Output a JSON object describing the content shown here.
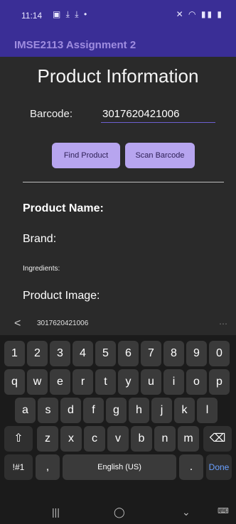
{
  "status_bar": {
    "time": "11:14",
    "left_icons": "▣ ⤓ ⤓ •",
    "right_icons": "✕ ◠ ▮▮ ▮"
  },
  "app_bar": {
    "title": "IMSE2113 Assignment 2"
  },
  "content": {
    "page_title": "Product Information",
    "barcode_label": "Barcode:",
    "barcode_value": "3017620421006",
    "find_button": "Find Product",
    "scan_button": "Scan Barcode",
    "product_name_label": "Product Name:",
    "brand_label": "Brand:",
    "ingredients_label": "Ingredients:",
    "product_image_label": "Product Image:"
  },
  "keyboard": {
    "clipboard_back": "<",
    "clipboard_text": "3017620421006",
    "clipboard_more": "⋯",
    "row_numbers": [
      "1",
      "2",
      "3",
      "4",
      "5",
      "6",
      "7",
      "8",
      "9",
      "0"
    ],
    "row_1": [
      "q",
      "w",
      "e",
      "r",
      "t",
      "y",
      "u",
      "i",
      "o",
      "p"
    ],
    "row_2": [
      "a",
      "s",
      "d",
      "f",
      "g",
      "h",
      "j",
      "k",
      "l"
    ],
    "row_3": [
      "z",
      "x",
      "c",
      "v",
      "b",
      "n",
      "m"
    ],
    "shift": "⇧",
    "backspace": "⌫",
    "symbols": "!#1",
    "comma": ",",
    "space": "English (US)",
    "period": ".",
    "done": "Done"
  },
  "nav_bar": {
    "recents": "|||",
    "home": "◯",
    "back": "⌄",
    "keyboard": "⌨"
  }
}
